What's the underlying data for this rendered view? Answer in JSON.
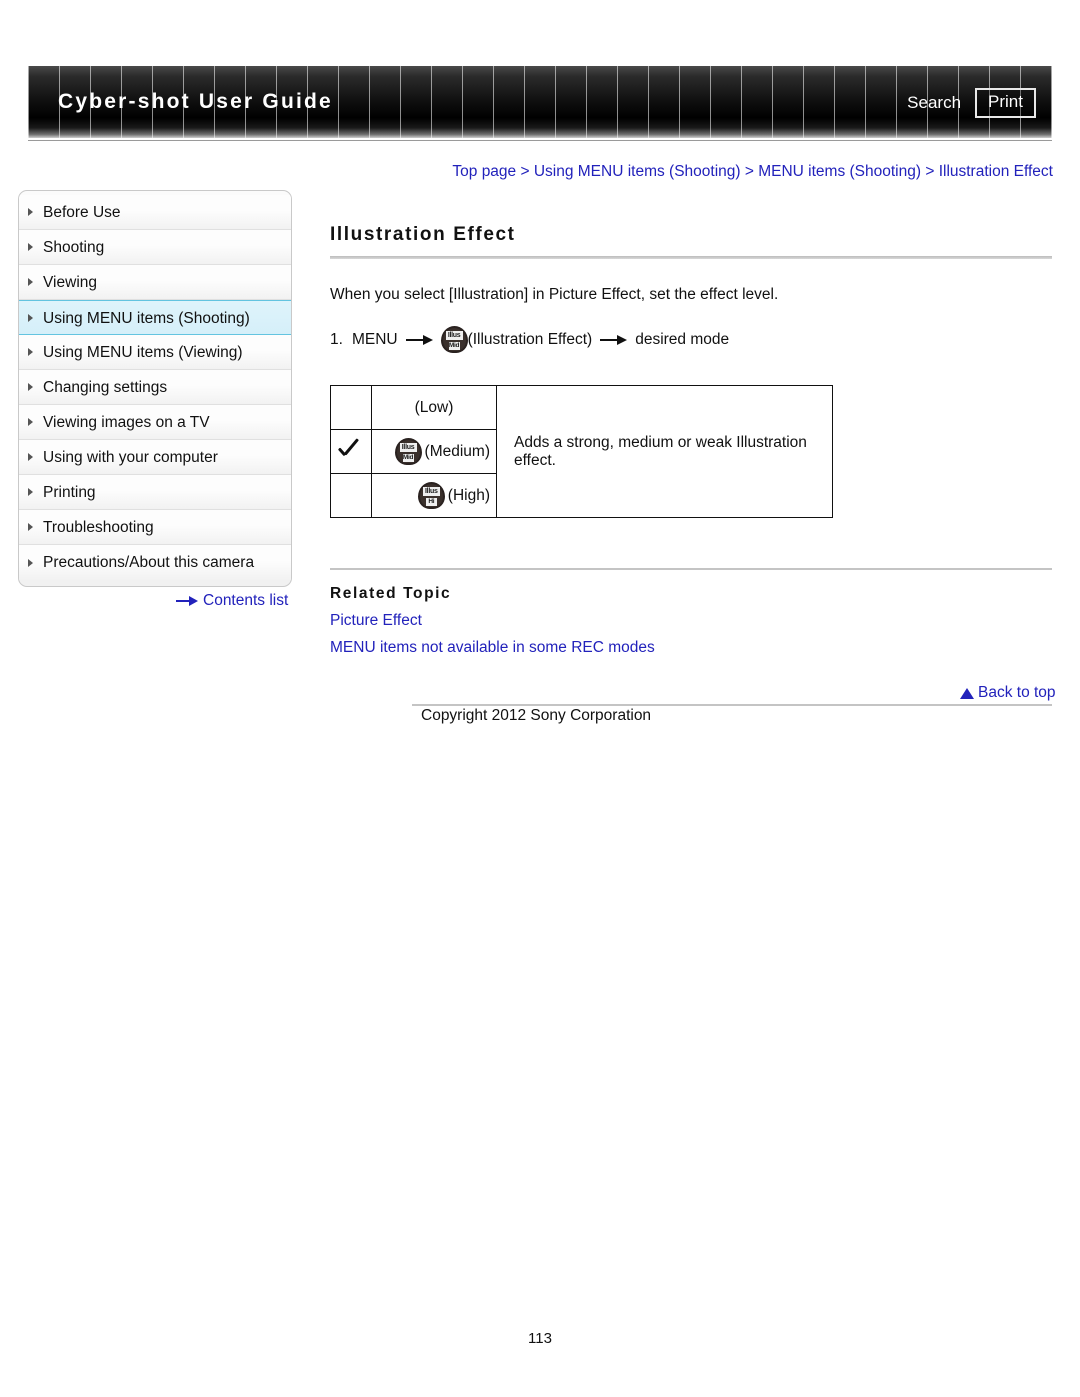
{
  "header": {
    "title": "Cyber-shot User Guide",
    "search_label": "Search",
    "print_label": "Print"
  },
  "breadcrumb": {
    "text": "Top page > Using MENU items (Shooting) > MENU items (Shooting) > Illustration Effect",
    "color": "#2222bb"
  },
  "sidebar": {
    "items": [
      {
        "label": "Before Use",
        "selected": false
      },
      {
        "label": "Shooting",
        "selected": false
      },
      {
        "label": "Viewing",
        "selected": false
      },
      {
        "label": "Using MENU items (Shooting)",
        "selected": true
      },
      {
        "label": "Using MENU items (Viewing)",
        "selected": false
      },
      {
        "label": "Changing settings",
        "selected": false
      },
      {
        "label": "Viewing images on a TV",
        "selected": false
      },
      {
        "label": "Using with your computer",
        "selected": false
      },
      {
        "label": "Printing",
        "selected": false
      },
      {
        "label": "Troubleshooting",
        "selected": false
      },
      {
        "label": "Precautions/About this camera",
        "selected": false
      }
    ],
    "contents_list_label": "Contents list",
    "selected_bg": "#d9f1fa",
    "selected_border": "#63c4e0"
  },
  "main": {
    "title": "Illustration Effect",
    "intro": "When you select [Illustration] in Picture Effect, set the effect level.",
    "step": {
      "number": "1.",
      "menu_label": "MENU",
      "icon_top": "Illus",
      "icon_bottom": "Mid",
      "icon_caption": "(Illustration Effect)",
      "tail": "desired mode"
    },
    "table": {
      "rows": [
        {
          "checked": "",
          "icon_top": "",
          "icon_bottom": "",
          "level": "(Low)",
          "has_icon": false
        },
        {
          "checked": "check",
          "icon_top": "Illus",
          "icon_bottom": "Mid",
          "level": "(Medium)",
          "has_icon": true
        },
        {
          "checked": "",
          "icon_top": "Illus",
          "icon_bottom": "Hi",
          "level": "(High)",
          "has_icon": true
        }
      ],
      "description": "Adds a strong, medium or weak Illustration effect."
    },
    "related": {
      "heading": "Related Topic",
      "links": [
        "Picture Effect",
        "MENU items not available in some REC modes"
      ]
    }
  },
  "footer": {
    "back_to_top": "Back to top",
    "copyright": "Copyright 2012 Sony Corporation",
    "page_number": "113"
  }
}
